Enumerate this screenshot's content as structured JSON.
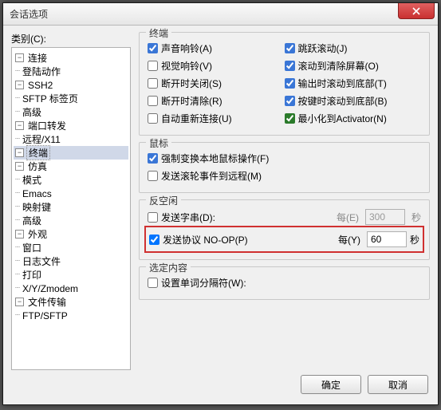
{
  "title": "会话选项",
  "categoryLabel": "类别(C):",
  "tree": {
    "connection": "连接",
    "loginAction": "登陆动作",
    "ssh2": "SSH2",
    "sftpTab": "SFTP 标签页",
    "advanced": "高级",
    "portFwd": "端口转发",
    "remoteX11": "远程/X11",
    "terminal": "终端",
    "emulation": "仿真",
    "mode": "模式",
    "emacs": "Emacs",
    "mapKeys": "映射键",
    "advanced2": "高级",
    "appearance": "外观",
    "window": "窗口",
    "logFile": "日志文件",
    "print": "打印",
    "xyzmodem": "X/Y/Zmodem",
    "fileTransfer": "文件传输",
    "ftpSftp": "FTP/SFTP"
  },
  "groups": {
    "terminal": "终端",
    "mouse": "鼠标",
    "antiIdle": "反空闲",
    "selection": "选定内容"
  },
  "checks": {
    "audioBell": "声音响铃(A)",
    "jumpScroll": "跳跃滚动(J)",
    "visualBell": "视觉响铃(V)",
    "clearOnScroll": "滚动到清除屏幕(O)",
    "closeOnDisc": "断开时关闭(S)",
    "scrollBottomOut": "输出时滚动到底部(T)",
    "clearOnDisc": "断开时清除(R)",
    "scrollBottomKey": "按键时滚动到底部(B)",
    "autoReconnect": "自动重新连接(U)",
    "minToActivator": "最小化到Activator(N)",
    "forceLocalMouse": "强制变换本地鼠标操作(F)",
    "sendScrollRemote": "发送滚轮事件到远程(M)",
    "sendString": "发送字串(D):",
    "sendProtocol": "发送协议 NO-OP(P)",
    "setWordDelim": "设置单词分隔符(W):"
  },
  "antiIdle": {
    "everyE": "每(E)",
    "everyY": "每(Y)",
    "val1": "300",
    "val2": "60",
    "unit": "秒"
  },
  "buttons": {
    "ok": "确定",
    "cancel": "取消"
  }
}
